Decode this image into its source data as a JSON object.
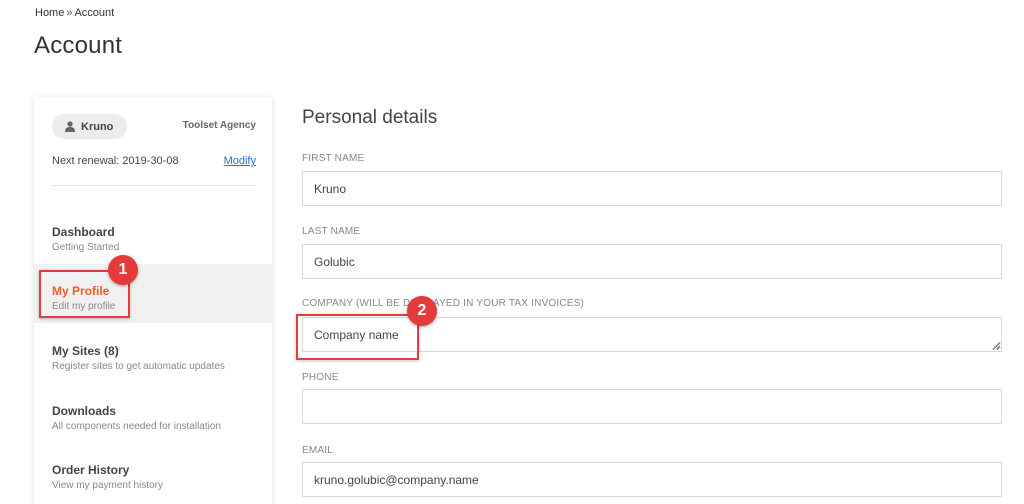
{
  "breadcrumb": {
    "home": "Home",
    "separator": "»",
    "current": "Account"
  },
  "page": {
    "title": "Account"
  },
  "sidebar": {
    "user_name": "Kruno",
    "user_icon": "user-icon",
    "agency": "Toolset Agency",
    "renewal_label": "Next renewal: 2019-30-08",
    "modify_label": "Modify",
    "items": [
      {
        "title": "Dashboard",
        "subtitle": "Getting Started",
        "active": false
      },
      {
        "title": "My Profile",
        "subtitle": "Edit my profile",
        "active": true
      },
      {
        "title": "My Sites (8)",
        "subtitle": "Register sites to get automatic updates",
        "active": false
      },
      {
        "title": "Downloads",
        "subtitle": "All components needed for installation",
        "active": false
      },
      {
        "title": "Order History",
        "subtitle": "View my payment history",
        "active": false
      }
    ]
  },
  "form": {
    "section_title": "Personal details",
    "fields": {
      "first_name": {
        "label": "FIRST NAME",
        "value": "Kruno"
      },
      "last_name": {
        "label": "LAST NAME",
        "value": "Golubic"
      },
      "company": {
        "label": "COMPANY (WILL BE DISPLAYED IN YOUR TAX INVOICES)",
        "value": "Company name"
      },
      "phone": {
        "label": "PHONE",
        "value": ""
      },
      "email": {
        "label": "EMAIL",
        "value": "kruno.golubic@company.name"
      }
    }
  },
  "annotations": {
    "badge_1": "1",
    "badge_2": "2",
    "color": "#e53a3a"
  },
  "colors": {
    "accent": "#f05a28",
    "link": "#2a6fc2",
    "active_bg": "#f1f1f1"
  }
}
